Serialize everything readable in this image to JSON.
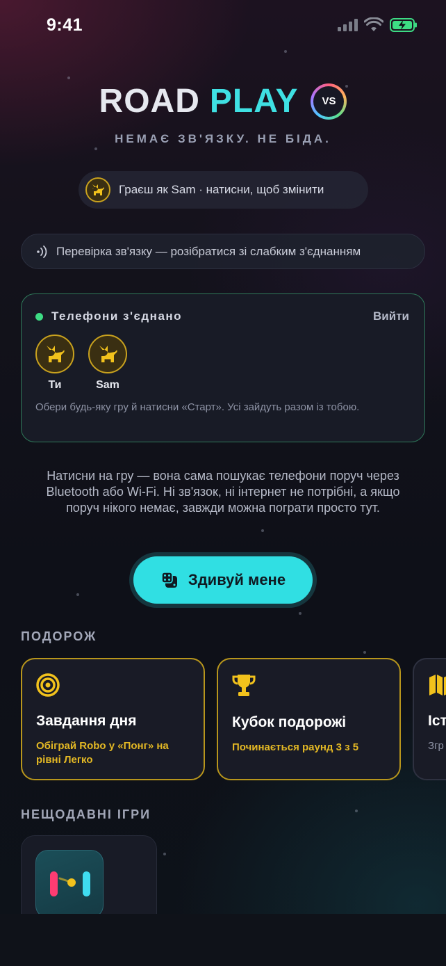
{
  "status_bar": {
    "time": "9:41"
  },
  "logo": {
    "word1": "ROAD",
    "word2": "PLAY",
    "badge": "VS"
  },
  "tagline": "НЕМАЄ ЗВ'ЯЗКУ. НЕ БІДА.",
  "player_pill": {
    "text": "Граєш як Sam · натисни, щоб змінити",
    "icon": "cat-icon"
  },
  "connection_check": {
    "text": "Перевірка зв'язку — розібратися зі слабким з'єднанням",
    "icon": "signal-waves-icon"
  },
  "connected_card": {
    "title": "Телефони з'єднано",
    "exit_label": "Вийти",
    "players": [
      {
        "name": "Ти",
        "icon": "cat-icon"
      },
      {
        "name": "Sam",
        "icon": "cat-icon"
      }
    ],
    "hint": "Обери будь-яку гру й натисни «Старт». Усі зайдуть разом із тобою.",
    "colors": {
      "border": "#2f7a5a",
      "dot": "#3ddc84"
    }
  },
  "description": "Натисни на гру — вона сама пошукає телефони поруч через Bluetooth або Wi-Fi. Ні зв'язок, ні інтернет не потрібні, а якщо поруч нікого немає, завжди можна пограти просто тут.",
  "surprise_button": {
    "label": "Здивуй мене",
    "icon": "dice-icon",
    "color": "#30dfe3"
  },
  "journey": {
    "title": "ПОДОРОЖ",
    "cards": [
      {
        "icon": "target-icon",
        "title": "Завдання дня",
        "subtitle": "Обіграй Robo у «Понг» на рівні Легко"
      },
      {
        "icon": "trophy-icon",
        "title": "Кубок подорожі",
        "subtitle": "Починається раунд 3 з 5"
      },
      {
        "icon": "map-icon",
        "title": "Іст",
        "subtitle": "Згр"
      }
    ],
    "accent": "#e3b824"
  },
  "recent": {
    "title": "НЕЩОДАВНІ ІГРИ",
    "games": [
      {
        "icon": "pong-icon"
      }
    ]
  }
}
